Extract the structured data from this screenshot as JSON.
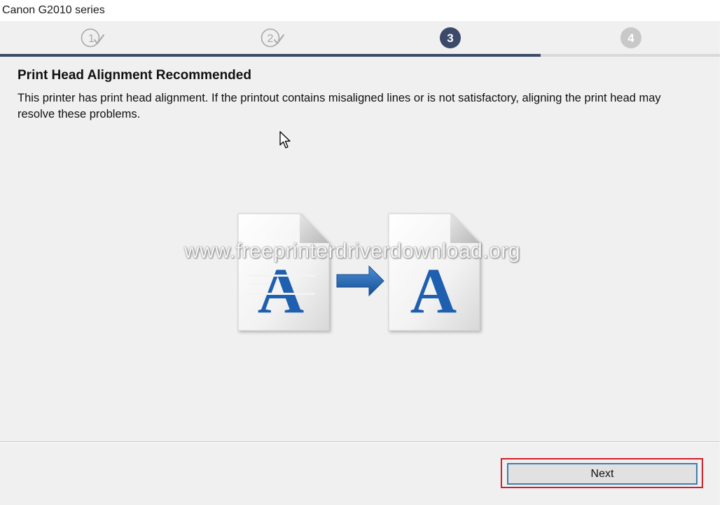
{
  "window": {
    "title": "Canon G2010 series"
  },
  "steps": {
    "items": [
      {
        "number": "1",
        "state": "completed"
      },
      {
        "number": "2",
        "state": "completed"
      },
      {
        "number": "3",
        "state": "current"
      },
      {
        "number": "4",
        "state": "upcoming"
      }
    ],
    "progress_fraction": 0.75
  },
  "content": {
    "heading": "Print Head Alignment Recommended",
    "description": "This printer has print head alignment. If the printout contains misaligned lines or is not satisfactory, aligning the print head may resolve these problems."
  },
  "illustration": {
    "before_letter": "A",
    "after_letter": "A",
    "letter_color": "#1f5fb0",
    "arrow_color": "#1d5fa8"
  },
  "watermark": {
    "text": "www.freeprinterdriverdownload.org"
  },
  "footer": {
    "next_label": "Next"
  },
  "colors": {
    "accent": "#3a4a68",
    "highlight": "#d2202a",
    "button_border": "#3c7fb1"
  }
}
